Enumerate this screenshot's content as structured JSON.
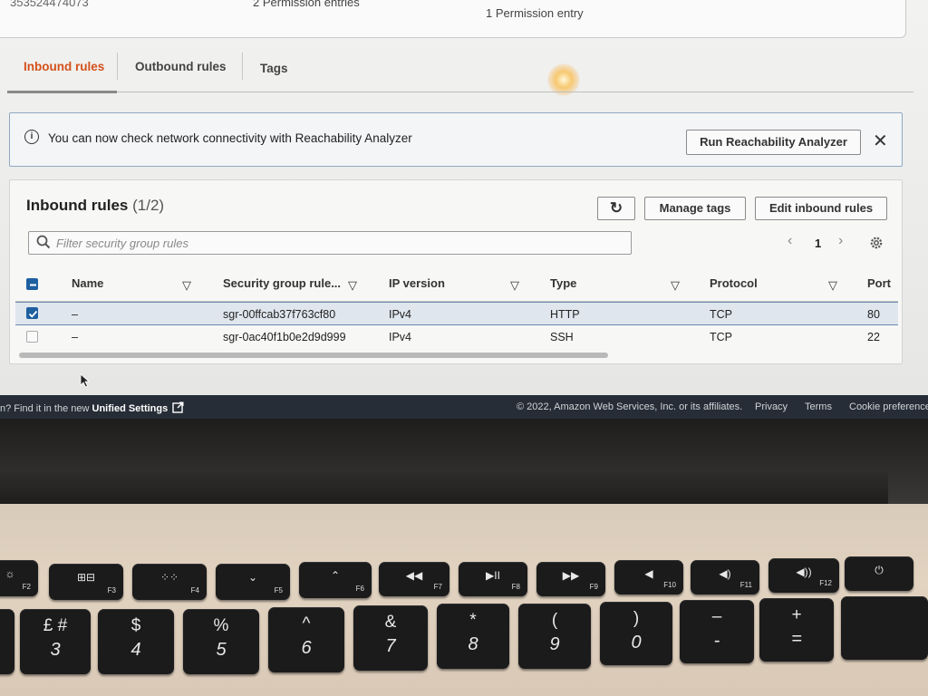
{
  "top_card": {
    "left_partial": "353524474073",
    "permission_entries": "2 Permission entries",
    "permission_entry": "1 Permission entry"
  },
  "tabs": [
    {
      "label": "Inbound rules",
      "active": true
    },
    {
      "label": "Outbound rules",
      "active": false
    },
    {
      "label": "Tags",
      "active": false
    }
  ],
  "flash": {
    "message": "You can now check network connectivity with Reachability Analyzer",
    "button": "Run Reachability Analyzer",
    "close": "✕"
  },
  "panel": {
    "title": "Inbound rules",
    "count": "(1/2)",
    "refresh": "↻",
    "manage_tags": "Manage tags",
    "edit_rules": "Edit inbound rules",
    "search_placeholder": "Filter security group rules",
    "page": "1"
  },
  "table": {
    "headers": [
      "Name",
      "Security group rule...",
      "IP version",
      "Type",
      "Protocol",
      "Port"
    ],
    "rows": [
      {
        "selected": true,
        "name": "–",
        "rule_id": "sgr-00ffcab37f763cf80",
        "ip_version": "IPv4",
        "type": "HTTP",
        "protocol": "TCP",
        "port": "80"
      },
      {
        "selected": false,
        "name": "–",
        "rule_id": "sgr-0ac40f1b0e2d9d999",
        "ip_version": "IPv4",
        "type": "SSH",
        "protocol": "TCP",
        "port": "22"
      }
    ]
  },
  "footer": {
    "left_text": "n? Find it in the new",
    "unified": "Unified Settings",
    "copyright": "© 2022, Amazon Web Services, Inc. or its affiliates.",
    "privacy": "Privacy",
    "terms": "Terms",
    "cookies": "Cookie preferences"
  },
  "keyboard": {
    "fn_row": [
      {
        "label": "F2",
        "sym": "☼"
      },
      {
        "label": "F3",
        "sym": "⊞⊟"
      },
      {
        "label": "F4",
        "sym": "⁘⁘"
      },
      {
        "label": "F5",
        "sym": "⌄"
      },
      {
        "label": "F6",
        "sym": "⌃"
      },
      {
        "label": "F7",
        "sym": "◀◀"
      },
      {
        "label": "F8",
        "sym": "▶II"
      },
      {
        "label": "F9",
        "sym": "▶▶"
      },
      {
        "label": "F10",
        "sym": "◀"
      },
      {
        "label": "F11",
        "sym": "◀)"
      },
      {
        "label": "F12",
        "sym": "◀))"
      },
      {
        "label": "",
        "sym": "⏻"
      }
    ],
    "num_row": [
      {
        "top": "£ #",
        "bot": "3"
      },
      {
        "top": "$",
        "bot": "4"
      },
      {
        "top": "%",
        "bot": "5"
      },
      {
        "top": "^",
        "bot": "6"
      },
      {
        "top": "&",
        "bot": "7"
      },
      {
        "top": "*",
        "bot": "8"
      },
      {
        "top": "(",
        "bot": "9"
      },
      {
        "top": ")",
        "bot": "0"
      },
      {
        "top": "–",
        "bot": "-"
      },
      {
        "top": "+",
        "bot": "="
      }
    ]
  }
}
